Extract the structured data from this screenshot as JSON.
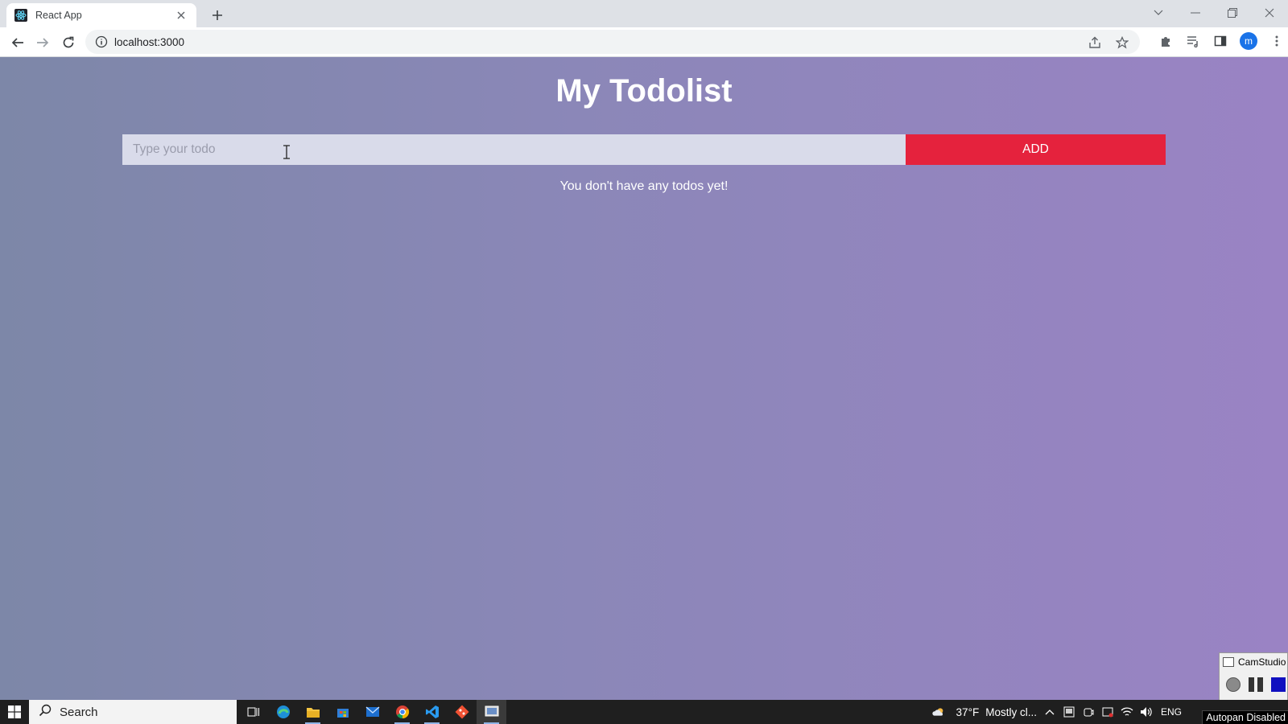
{
  "browser": {
    "tab_title": "React App",
    "url": "localhost:3000",
    "profile_initial": "m"
  },
  "app": {
    "title": "My Todolist",
    "input_placeholder": "Type your todo",
    "input_value": "",
    "add_label": "ADD",
    "empty_message": "You don't have any todos yet!"
  },
  "colors": {
    "add_button": "#e5223d",
    "input_bg": "#d9dbea",
    "gradient_start": "#7d87a8",
    "gradient_end": "#9a83c4"
  },
  "camstudio": {
    "title": "CamStudio",
    "status": "Autopan Disabled"
  },
  "taskbar": {
    "search_label": "Search",
    "weather_temp": "37°F",
    "weather_text": "Mostly cl...",
    "language": "ENG",
    "apps": [
      "task-view",
      "edge",
      "file-explorer",
      "store",
      "mail",
      "chrome",
      "vscode",
      "git",
      "camstudio"
    ]
  }
}
